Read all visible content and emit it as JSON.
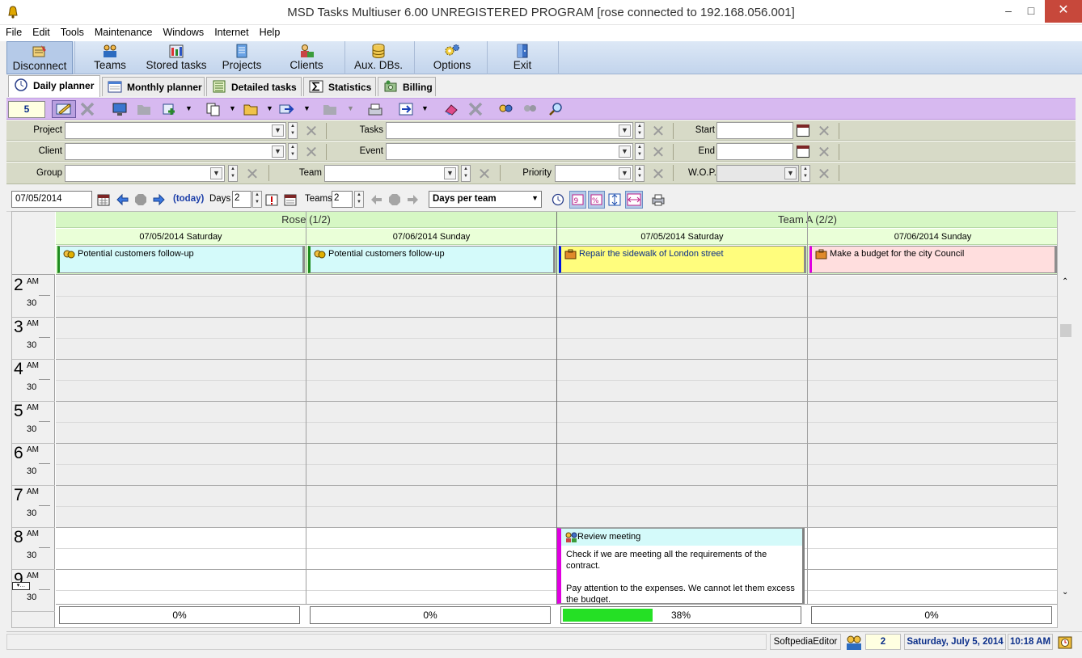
{
  "window": {
    "title": "MSD Tasks Multiuser 6.00 UNREGISTERED PROGRAM [rose connected to 192.168.056.001]",
    "minimize": "–",
    "maximize": "□",
    "close": "✕"
  },
  "menu": [
    "File",
    "Edit",
    "Tools",
    "Maintenance",
    "Windows",
    "Internet",
    "Help"
  ],
  "toolbar": {
    "disconnect": "Disconnect",
    "teams": "Teams",
    "stored_tasks": "Stored tasks",
    "projects": "Projects",
    "clients": "Clients",
    "aux_dbs": "Aux. DBs.",
    "options": "Options",
    "exit": "Exit"
  },
  "tabs": {
    "daily": "Daily planner",
    "monthly": "Monthly planner",
    "detailed": "Detailed tasks",
    "statistics": "Statistics",
    "billing": "Billing"
  },
  "action_bar": {
    "number": "5"
  },
  "filters": {
    "project": "Project",
    "tasks": "Tasks",
    "start": "Start",
    "client": "Client",
    "event": "Event",
    "end": "End",
    "group": "Group",
    "team": "Team",
    "priority": "Priority",
    "wop": "W.O.P."
  },
  "nav": {
    "date": "07/05/2014",
    "today": "(today)",
    "days_label": "Days",
    "days_value": "2",
    "teams_label": "Teams",
    "teams_value": "2",
    "view_mode": "Days per team"
  },
  "planner": {
    "teams": [
      {
        "name": "Rose  (1/2)"
      },
      {
        "name": "Team A  (2/2)"
      }
    ],
    "days": [
      "07/05/2014 Saturday",
      "07/06/2014 Sunday",
      "07/05/2014 Saturday",
      "07/06/2014 Sunday"
    ],
    "all_day_tasks": [
      {
        "title": "Potential customers follow-up",
        "color": "#d4fafa",
        "accent": "#1f8c1f"
      },
      {
        "title": "Potential customers follow-up",
        "color": "#d4fafa",
        "accent": "#1f8c1f"
      },
      {
        "title": "Repair the sidewalk of London street",
        "color": "#fffd7d",
        "accent": "#0016e0"
      },
      {
        "title": "Make a budget for the city Council",
        "color": "#ffdede",
        "accent": "#e000e0"
      }
    ],
    "hours": [
      {
        "h": "2",
        "ap": "AM",
        "half": "30"
      },
      {
        "h": "3",
        "ap": "AM",
        "half": "30"
      },
      {
        "h": "4",
        "ap": "AM",
        "half": "30"
      },
      {
        "h": "5",
        "ap": "AM",
        "half": "30"
      },
      {
        "h": "6",
        "ap": "AM",
        "half": "30"
      },
      {
        "h": "7",
        "ap": "AM",
        "half": "30"
      },
      {
        "h": "8",
        "ap": "AM",
        "half": "30"
      },
      {
        "h": "9",
        "ap": "AM",
        "half": "30"
      }
    ],
    "event": {
      "title": "Review meeting",
      "line1": "Check if we are meeting all the requirements of the contract.",
      "line2": "Pay attention to the expenses. We cannot let them excess the budget.",
      "accent": "#e000e0"
    },
    "progress": [
      {
        "label": "0%",
        "value": 0
      },
      {
        "label": "0%",
        "value": 0
      },
      {
        "label": "38%",
        "value": 38
      },
      {
        "label": "0%",
        "value": 0
      }
    ]
  },
  "status": {
    "user": "SoftpediaEditor",
    "count": "2",
    "date": "Saturday, July 5, 2014",
    "time": "10:18 AM"
  }
}
